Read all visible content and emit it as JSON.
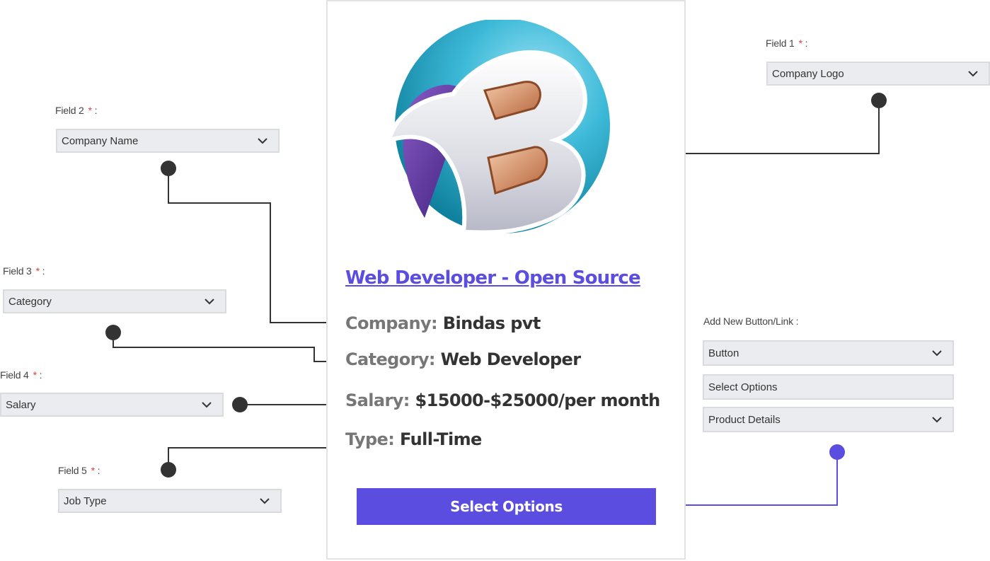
{
  "job": {
    "title": "Web Developer - Open Source",
    "company_key": "Company:",
    "company_value": "Bindas pvt",
    "category_key": "Category:",
    "category_value": "Web Developer",
    "salary_key": "Salary:",
    "salary_value": "$15000-$25000/per month",
    "type_key": "Type:",
    "type_value": "Full-Time",
    "cta_label": "Select Options"
  },
  "logo": {
    "letter": "B"
  },
  "fields": {
    "field1": {
      "label": "Field 1",
      "required": "*",
      "sep": ":",
      "value": "Company Logo"
    },
    "field2": {
      "label": "Field 2",
      "required": "*",
      "sep": ":",
      "value": "Company Name"
    },
    "field3": {
      "label": "Field 3",
      "required": "*",
      "sep": ":",
      "value": "Category"
    },
    "field4": {
      "label": "Field 4",
      "required": "*",
      "sep": ":",
      "value": "Salary"
    },
    "field5": {
      "label": "Field 5",
      "required": "*",
      "sep": ":",
      "value": "Job Type"
    }
  },
  "add_button": {
    "label": "Add New Button/Link :",
    "type_value": "Button",
    "text_value": "Select Options",
    "link_value": "Product Details"
  },
  "colors": {
    "accent": "#5b4de0",
    "connector": "#333333",
    "required": "#e23b3b"
  }
}
